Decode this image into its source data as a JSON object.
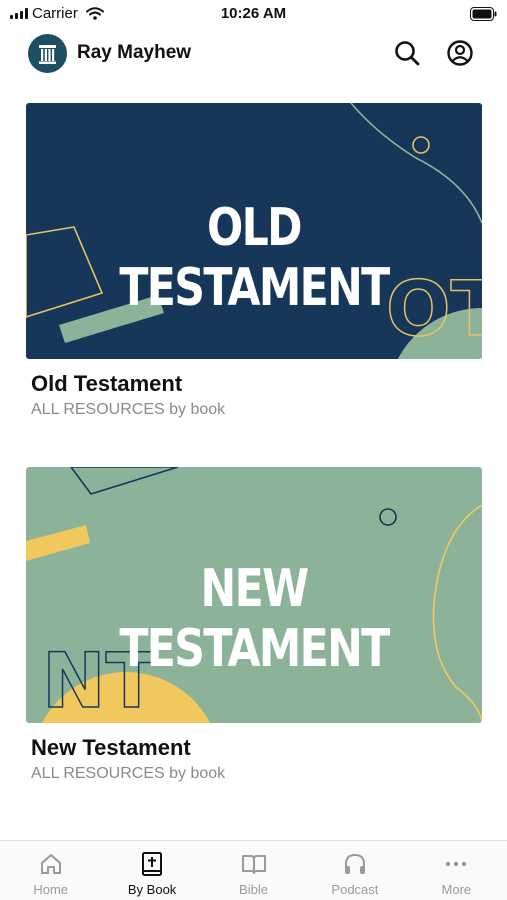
{
  "status_bar": {
    "carrier": "Carrier",
    "time": "10:26 AM"
  },
  "header": {
    "title": "Ray Mayhew",
    "icons": [
      "avatar-logo",
      "search-icon",
      "account-icon"
    ]
  },
  "cards": [
    {
      "art_title": "OLD TESTAMENT",
      "art_initials": "OT",
      "title": "Old Testament",
      "subtitle": "ALL RESOURCES by book",
      "colors": {
        "background": "#16365a",
        "accent_green": "#8db29a",
        "accent_gold": "#e8c062"
      }
    },
    {
      "art_title": "NEW TESTAMENT",
      "art_initials": "NT",
      "title": "New Testament",
      "subtitle": "ALL RESOURCES by book",
      "colors": {
        "background": "#8db29a",
        "accent_navy": "#16365a",
        "accent_gold": "#f0c85e"
      }
    }
  ],
  "tab_bar": {
    "active": "By Book",
    "tabs": [
      {
        "label": "Home",
        "icon": "home-icon"
      },
      {
        "label": "By Book",
        "icon": "bible-book-icon"
      },
      {
        "label": "Bible",
        "icon": "open-book-icon"
      },
      {
        "label": "Podcast",
        "icon": "headphones-icon"
      },
      {
        "label": "More",
        "icon": "more-dots-icon"
      }
    ]
  }
}
